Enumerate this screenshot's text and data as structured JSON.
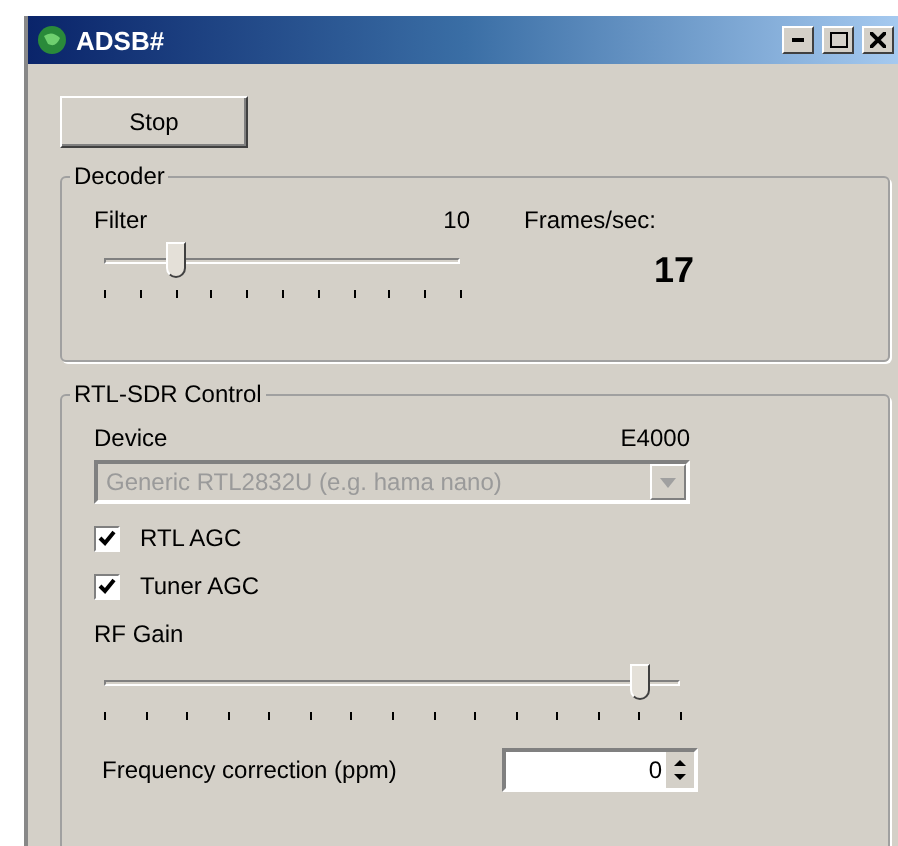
{
  "window": {
    "title": "ADSB#"
  },
  "stop_button": {
    "label": "Stop"
  },
  "decoder": {
    "title": "Decoder",
    "filter_label": "Filter",
    "filter_value": "10",
    "filter_slider": {
      "level": 0.2
    },
    "frames_label": "Frames/sec:",
    "frames_value": "17"
  },
  "rtl_sdr": {
    "title": "RTL-SDR Control",
    "device_label": "Device",
    "tuner": "E4000",
    "device_select": {
      "value": "Generic RTL2832U (e.g. hama nano)",
      "disabled": true
    },
    "checkboxes": [
      {
        "label": "RTL AGC",
        "checked": true
      },
      {
        "label": "Tuner AGC",
        "checked": true
      }
    ],
    "rf_gain_label": "RF Gain",
    "rf_gain_slider": {
      "level": 0.93
    },
    "frequency_correction": {
      "label": "Frequency correction (ppm)",
      "value": "0"
    }
  }
}
